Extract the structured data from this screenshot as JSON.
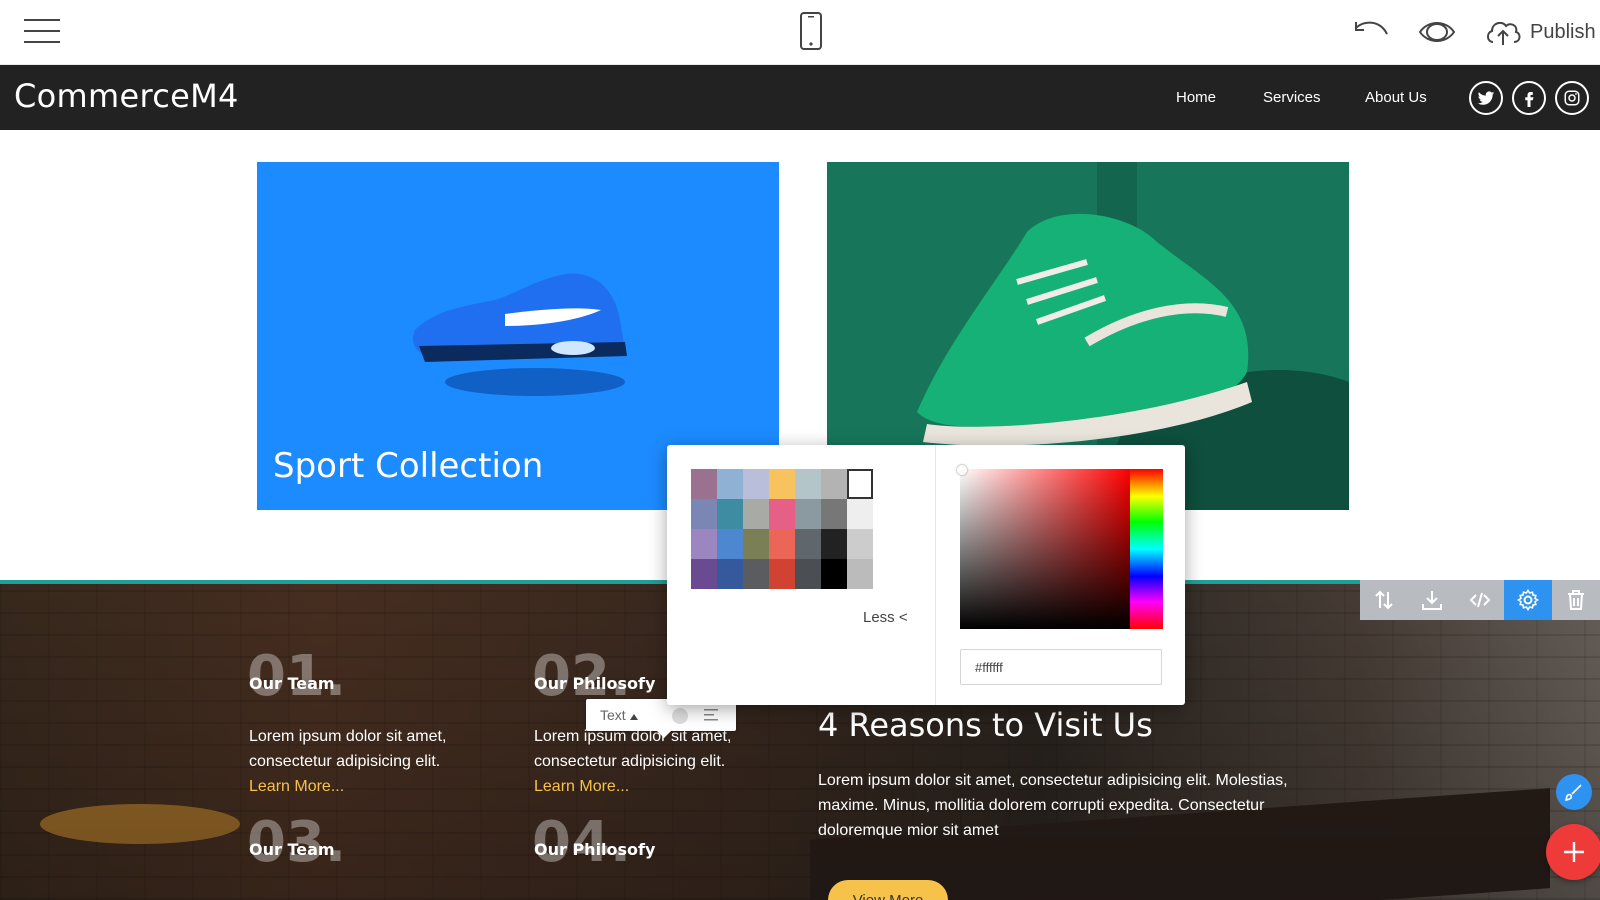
{
  "editor": {
    "icons": [
      "hamburger-icon",
      "phone-icon",
      "undo-icon",
      "eye-icon",
      "cloud-upload-icon"
    ],
    "publish_label": "Publish"
  },
  "site": {
    "brand": "CommerceM4",
    "nav": [
      "Home",
      "Services",
      "About Us"
    ],
    "social_icons": [
      "twitter-icon",
      "facebook-icon",
      "instagram-icon"
    ],
    "nav_bg": "#222222"
  },
  "cards": {
    "sport_title": "Sport Collection",
    "sport_bg": "#1c8bff"
  },
  "reasons": {
    "items": [
      {
        "num": "01.",
        "title": "Our Team",
        "line1": "Lorem ipsum dolor sit amet,",
        "line2": "consectetur adipisicing elit.",
        "link": "Learn More..."
      },
      {
        "num": "02.",
        "title": "Our Philosofy",
        "line1": "Lorem ipsum dolor sit amet,",
        "line2": "consectetur adipisicing elit.",
        "link": "Learn More..."
      },
      {
        "num": "03.",
        "title": "Our Team"
      },
      {
        "num": "04.",
        "title": "Our Philosofy"
      }
    ],
    "heading": "4 Reasons to Visit Us",
    "text": "Lorem ipsum dolor sit amet, consectetur adipisicing elit. Molestias, maxime. Minus, mollitia dolorem corrupti expedita. Consectetur doloremque mior sit amet",
    "button": "View More",
    "accent": "#1e9f98",
    "link_color": "#f7c24a"
  },
  "block_toolbar": {
    "icons": [
      "move-icon",
      "download-icon",
      "code-icon",
      "gear-icon",
      "trash-icon"
    ],
    "active": "gear-icon",
    "active_color": "#2d92f0"
  },
  "text_toolbar": {
    "label": "Text",
    "icons": [
      "caret-up-icon",
      "circle-icon",
      "align-icon"
    ]
  },
  "color_picker": {
    "swatches": [
      "#9b7190",
      "#8fb1d4",
      "#b9bedb",
      "#f8c25f",
      "#b4c5ca",
      "#b3b3b3",
      "#ffffff",
      "#7a86b3",
      "#3d8ca2",
      "#a7aaa5",
      "#e55f86",
      "#8b9aa0",
      "#777777",
      "#eeeeee",
      "#9b86bf",
      "#4d87cf",
      "#7b7f55",
      "#ec6658",
      "#5f676d",
      "#222222",
      "#cccccc",
      "#6a4b92",
      "#36599e",
      "#5a5c60",
      "#d04232",
      "#4b4f53",
      "#000000",
      "#bbbbbb"
    ],
    "selected_index": 6,
    "less_label": "Less <",
    "hex_value": "#ffffff",
    "hue": "#ff0000"
  }
}
